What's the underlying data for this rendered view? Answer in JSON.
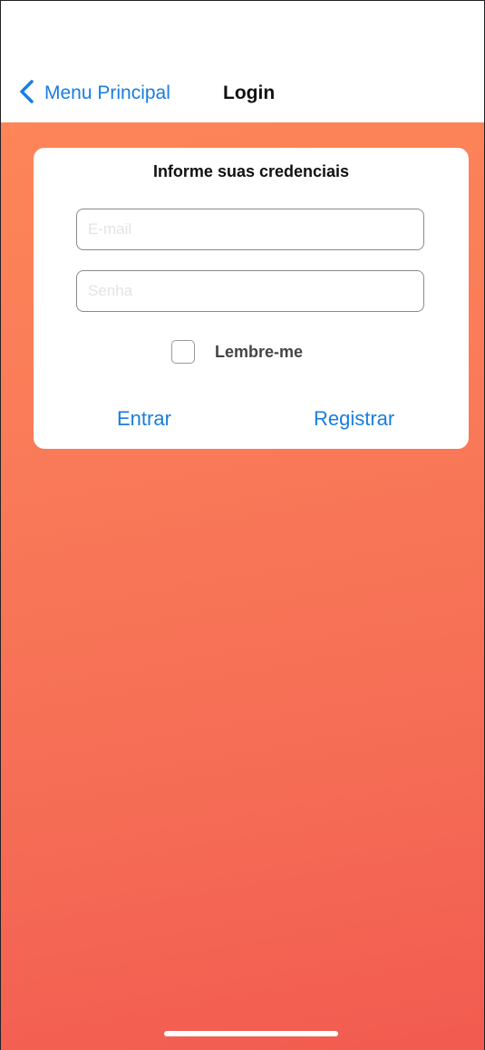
{
  "nav": {
    "back_label": "Menu Principal",
    "title": "Login"
  },
  "card": {
    "title": "Informe suas credenciais",
    "email_placeholder": "E-mail",
    "password_placeholder": "Senha",
    "remember_label": "Lembre-me",
    "remember_checked": false,
    "enter_label": "Entrar",
    "register_label": "Registrar"
  },
  "colors": {
    "accent": "#1a7de0",
    "gradient_top": "#fd8558",
    "gradient_bottom": "#f25b50"
  },
  "icons": {
    "back": "chevron-left-icon"
  }
}
